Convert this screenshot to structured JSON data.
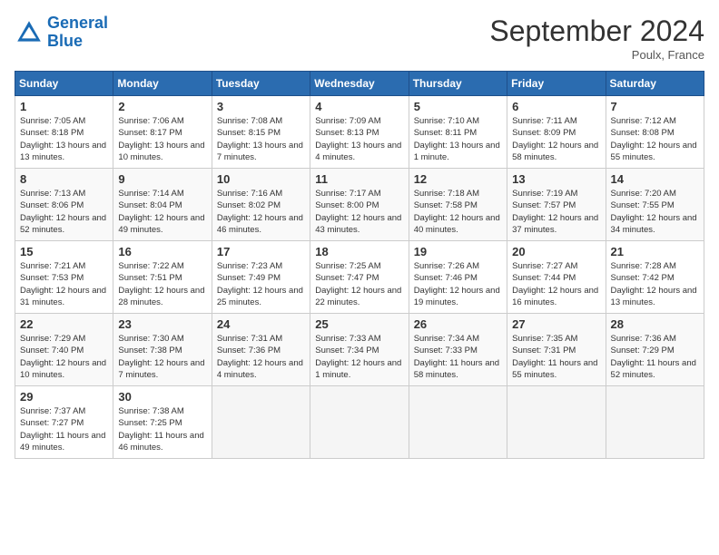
{
  "header": {
    "logo_line1": "General",
    "logo_line2": "Blue",
    "title": "September 2024",
    "location": "Poulx, France"
  },
  "days_of_week": [
    "Sunday",
    "Monday",
    "Tuesday",
    "Wednesday",
    "Thursday",
    "Friday",
    "Saturday"
  ],
  "weeks": [
    [
      {
        "day": "1",
        "sunrise": "Sunrise: 7:05 AM",
        "sunset": "Sunset: 8:18 PM",
        "daylight": "Daylight: 13 hours and 13 minutes."
      },
      {
        "day": "2",
        "sunrise": "Sunrise: 7:06 AM",
        "sunset": "Sunset: 8:17 PM",
        "daylight": "Daylight: 13 hours and 10 minutes."
      },
      {
        "day": "3",
        "sunrise": "Sunrise: 7:08 AM",
        "sunset": "Sunset: 8:15 PM",
        "daylight": "Daylight: 13 hours and 7 minutes."
      },
      {
        "day": "4",
        "sunrise": "Sunrise: 7:09 AM",
        "sunset": "Sunset: 8:13 PM",
        "daylight": "Daylight: 13 hours and 4 minutes."
      },
      {
        "day": "5",
        "sunrise": "Sunrise: 7:10 AM",
        "sunset": "Sunset: 8:11 PM",
        "daylight": "Daylight: 13 hours and 1 minute."
      },
      {
        "day": "6",
        "sunrise": "Sunrise: 7:11 AM",
        "sunset": "Sunset: 8:09 PM",
        "daylight": "Daylight: 12 hours and 58 minutes."
      },
      {
        "day": "7",
        "sunrise": "Sunrise: 7:12 AM",
        "sunset": "Sunset: 8:08 PM",
        "daylight": "Daylight: 12 hours and 55 minutes."
      }
    ],
    [
      {
        "day": "8",
        "sunrise": "Sunrise: 7:13 AM",
        "sunset": "Sunset: 8:06 PM",
        "daylight": "Daylight: 12 hours and 52 minutes."
      },
      {
        "day": "9",
        "sunrise": "Sunrise: 7:14 AM",
        "sunset": "Sunset: 8:04 PM",
        "daylight": "Daylight: 12 hours and 49 minutes."
      },
      {
        "day": "10",
        "sunrise": "Sunrise: 7:16 AM",
        "sunset": "Sunset: 8:02 PM",
        "daylight": "Daylight: 12 hours and 46 minutes."
      },
      {
        "day": "11",
        "sunrise": "Sunrise: 7:17 AM",
        "sunset": "Sunset: 8:00 PM",
        "daylight": "Daylight: 12 hours and 43 minutes."
      },
      {
        "day": "12",
        "sunrise": "Sunrise: 7:18 AM",
        "sunset": "Sunset: 7:58 PM",
        "daylight": "Daylight: 12 hours and 40 minutes."
      },
      {
        "day": "13",
        "sunrise": "Sunrise: 7:19 AM",
        "sunset": "Sunset: 7:57 PM",
        "daylight": "Daylight: 12 hours and 37 minutes."
      },
      {
        "day": "14",
        "sunrise": "Sunrise: 7:20 AM",
        "sunset": "Sunset: 7:55 PM",
        "daylight": "Daylight: 12 hours and 34 minutes."
      }
    ],
    [
      {
        "day": "15",
        "sunrise": "Sunrise: 7:21 AM",
        "sunset": "Sunset: 7:53 PM",
        "daylight": "Daylight: 12 hours and 31 minutes."
      },
      {
        "day": "16",
        "sunrise": "Sunrise: 7:22 AM",
        "sunset": "Sunset: 7:51 PM",
        "daylight": "Daylight: 12 hours and 28 minutes."
      },
      {
        "day": "17",
        "sunrise": "Sunrise: 7:23 AM",
        "sunset": "Sunset: 7:49 PM",
        "daylight": "Daylight: 12 hours and 25 minutes."
      },
      {
        "day": "18",
        "sunrise": "Sunrise: 7:25 AM",
        "sunset": "Sunset: 7:47 PM",
        "daylight": "Daylight: 12 hours and 22 minutes."
      },
      {
        "day": "19",
        "sunrise": "Sunrise: 7:26 AM",
        "sunset": "Sunset: 7:46 PM",
        "daylight": "Daylight: 12 hours and 19 minutes."
      },
      {
        "day": "20",
        "sunrise": "Sunrise: 7:27 AM",
        "sunset": "Sunset: 7:44 PM",
        "daylight": "Daylight: 12 hours and 16 minutes."
      },
      {
        "day": "21",
        "sunrise": "Sunrise: 7:28 AM",
        "sunset": "Sunset: 7:42 PM",
        "daylight": "Daylight: 12 hours and 13 minutes."
      }
    ],
    [
      {
        "day": "22",
        "sunrise": "Sunrise: 7:29 AM",
        "sunset": "Sunset: 7:40 PM",
        "daylight": "Daylight: 12 hours and 10 minutes."
      },
      {
        "day": "23",
        "sunrise": "Sunrise: 7:30 AM",
        "sunset": "Sunset: 7:38 PM",
        "daylight": "Daylight: 12 hours and 7 minutes."
      },
      {
        "day": "24",
        "sunrise": "Sunrise: 7:31 AM",
        "sunset": "Sunset: 7:36 PM",
        "daylight": "Daylight: 12 hours and 4 minutes."
      },
      {
        "day": "25",
        "sunrise": "Sunrise: 7:33 AM",
        "sunset": "Sunset: 7:34 PM",
        "daylight": "Daylight: 12 hours and 1 minute."
      },
      {
        "day": "26",
        "sunrise": "Sunrise: 7:34 AM",
        "sunset": "Sunset: 7:33 PM",
        "daylight": "Daylight: 11 hours and 58 minutes."
      },
      {
        "day": "27",
        "sunrise": "Sunrise: 7:35 AM",
        "sunset": "Sunset: 7:31 PM",
        "daylight": "Daylight: 11 hours and 55 minutes."
      },
      {
        "day": "28",
        "sunrise": "Sunrise: 7:36 AM",
        "sunset": "Sunset: 7:29 PM",
        "daylight": "Daylight: 11 hours and 52 minutes."
      }
    ],
    [
      {
        "day": "29",
        "sunrise": "Sunrise: 7:37 AM",
        "sunset": "Sunset: 7:27 PM",
        "daylight": "Daylight: 11 hours and 49 minutes."
      },
      {
        "day": "30",
        "sunrise": "Sunrise: 7:38 AM",
        "sunset": "Sunset: 7:25 PM",
        "daylight": "Daylight: 11 hours and 46 minutes."
      },
      null,
      null,
      null,
      null,
      null
    ]
  ]
}
